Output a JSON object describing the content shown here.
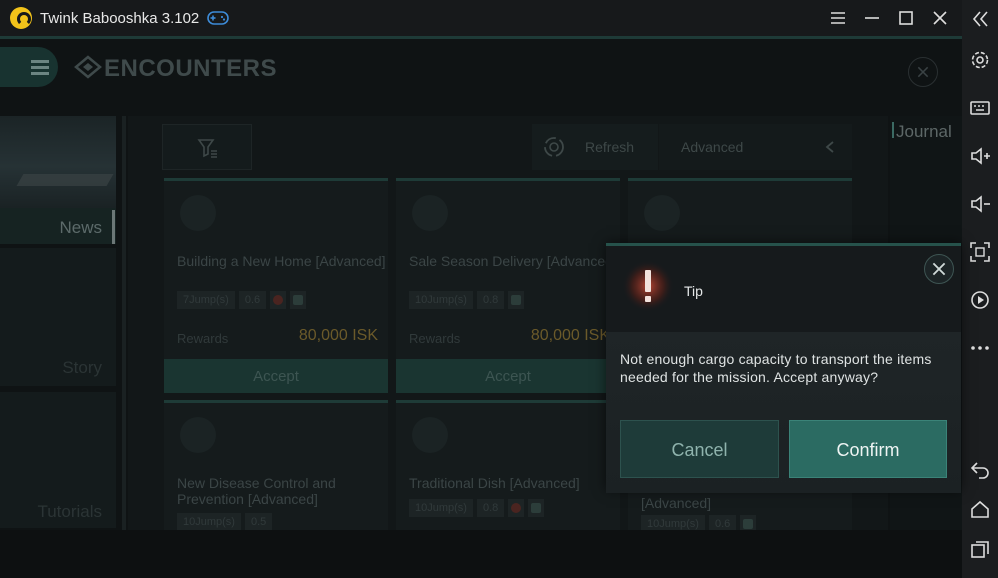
{
  "window": {
    "app_title": "Twink Babooshka 3.102",
    "icons": [
      "gamepad-icon",
      "hamburger-icon",
      "minimize-icon",
      "maximize-icon",
      "close-icon",
      "collapse-icon"
    ]
  },
  "sidebar_right": {
    "icons": [
      "collapse-icon",
      "settings-icon",
      "keyboard-icon",
      "volume-up-icon",
      "volume-down-icon",
      "screenshot-icon",
      "record-icon",
      "more-icon",
      "back-icon",
      "home-icon",
      "recent-apps-icon"
    ]
  },
  "game": {
    "header": {
      "title": "ENCOUNTERS"
    },
    "left_nav": {
      "news": "News",
      "story": "Story",
      "tutorials": "Tutorials"
    },
    "toolbar": {
      "refresh": "Refresh",
      "advanced": "Advanced"
    },
    "journal": "Journal",
    "cards": [
      {
        "title": "Building a New Home [Advanced]",
        "jumps": "7Jump(s)",
        "security": "0.6",
        "rewards_label": "Rewards",
        "reward": "80,000 ISK",
        "accept": "Accept"
      },
      {
        "title": "Sale Season Delivery [Advanced]",
        "jumps": "10Jump(s)",
        "security": "0.8",
        "rewards_label": "Rewards",
        "reward": "80,000 ISK",
        "accept": "Accept"
      },
      {
        "title": "",
        "jumps": "",
        "security": "",
        "rewards_label": "",
        "reward": "",
        "accept": ""
      },
      {
        "title": "New Disease Control and Prevention [Advanced]",
        "jumps": "10Jump(s)",
        "security": "0.5"
      },
      {
        "title": "Traditional Dish [Advanced]",
        "jumps": "10Jump(s)",
        "security": "0.8"
      },
      {
        "title": "[Advanced]",
        "jumps": "10Jump(s)",
        "security": "0.6"
      }
    ]
  },
  "dialog": {
    "title": "Tip",
    "message": "Not enough cargo capacity to transport the items needed for the mission. Accept anyway?",
    "cancel": "Cancel",
    "confirm": "Confirm",
    "accent": "#2b6b62",
    "warning_color": "#c84a36"
  }
}
